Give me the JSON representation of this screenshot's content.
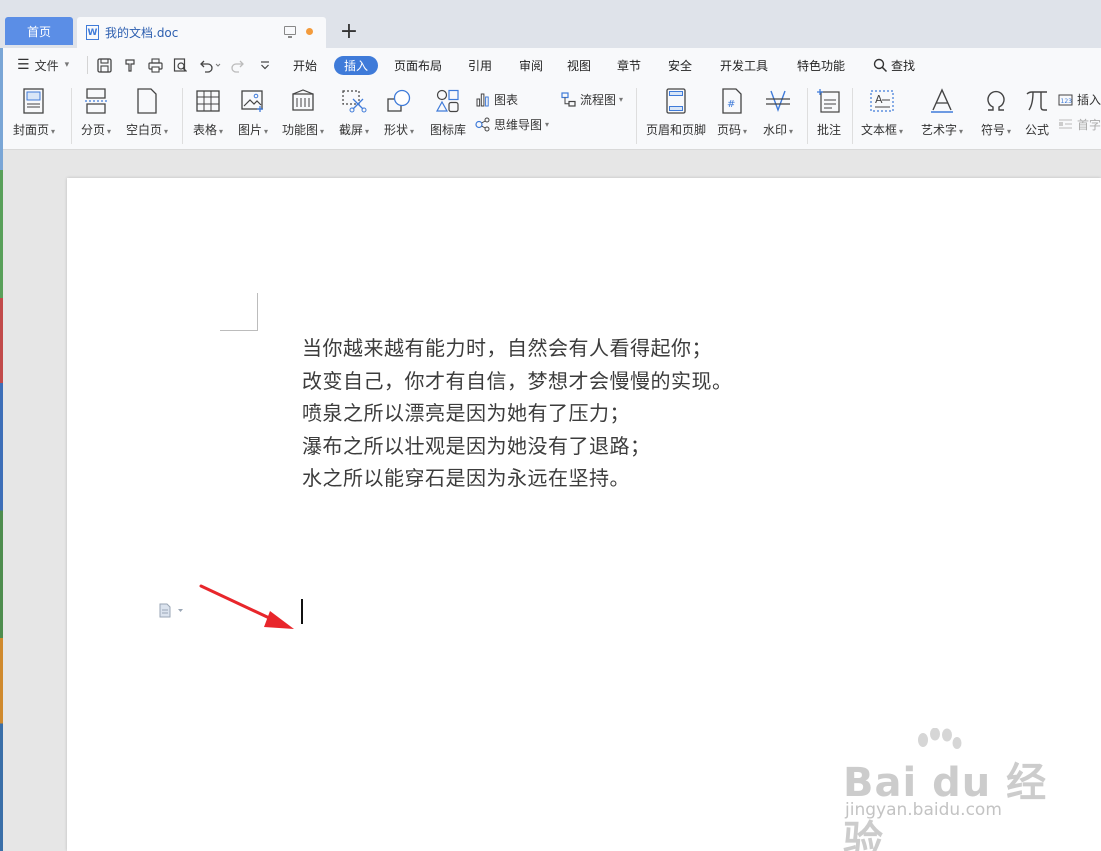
{
  "tabs": {
    "home": "首页",
    "document": "我的文档.doc"
  },
  "menu": {
    "file": "文件",
    "items": [
      "开始",
      "插入",
      "页面布局",
      "引用",
      "审阅",
      "视图",
      "章节",
      "安全",
      "开发工具",
      "特色功能"
    ],
    "active": "插入",
    "search": "查找"
  },
  "ribbon": {
    "cover_page": "封面页",
    "page_break": "分页",
    "blank_page": "空白页",
    "table": "表格",
    "picture": "图片",
    "function_chart": "功能图",
    "screenshot": "截屏",
    "shape": "形状",
    "icon_library": "图标库",
    "chart": "图表",
    "mind_map": "思维导图",
    "flowchart": "流程图",
    "header_footer": "页眉和页脚",
    "page_number": "页码",
    "watermark": "水印",
    "comment": "批注",
    "text_box": "文本框",
    "word_art": "艺术字",
    "symbol": "符号",
    "formula": "公式",
    "insert_number": "插入",
    "drop_cap": "首字"
  },
  "document": {
    "lines": [
      "当你越来越有能力时，自然会有人看得起你；",
      "改变自己，你才有自信，梦想才会慢慢的实现。",
      "喷泉之所以漂亮是因为她有了压力；",
      "瀑布之所以壮观是因为她没有了退路；",
      "水之所以能穿石是因为永远在坚持。"
    ]
  },
  "watermark": {
    "brand": "Bai du 经验",
    "url": "jingyan.baidu.com"
  },
  "colors": {
    "accent": "#3f7bd9",
    "arrow": "#e8262b",
    "modified_dot": "#f39b3c"
  }
}
